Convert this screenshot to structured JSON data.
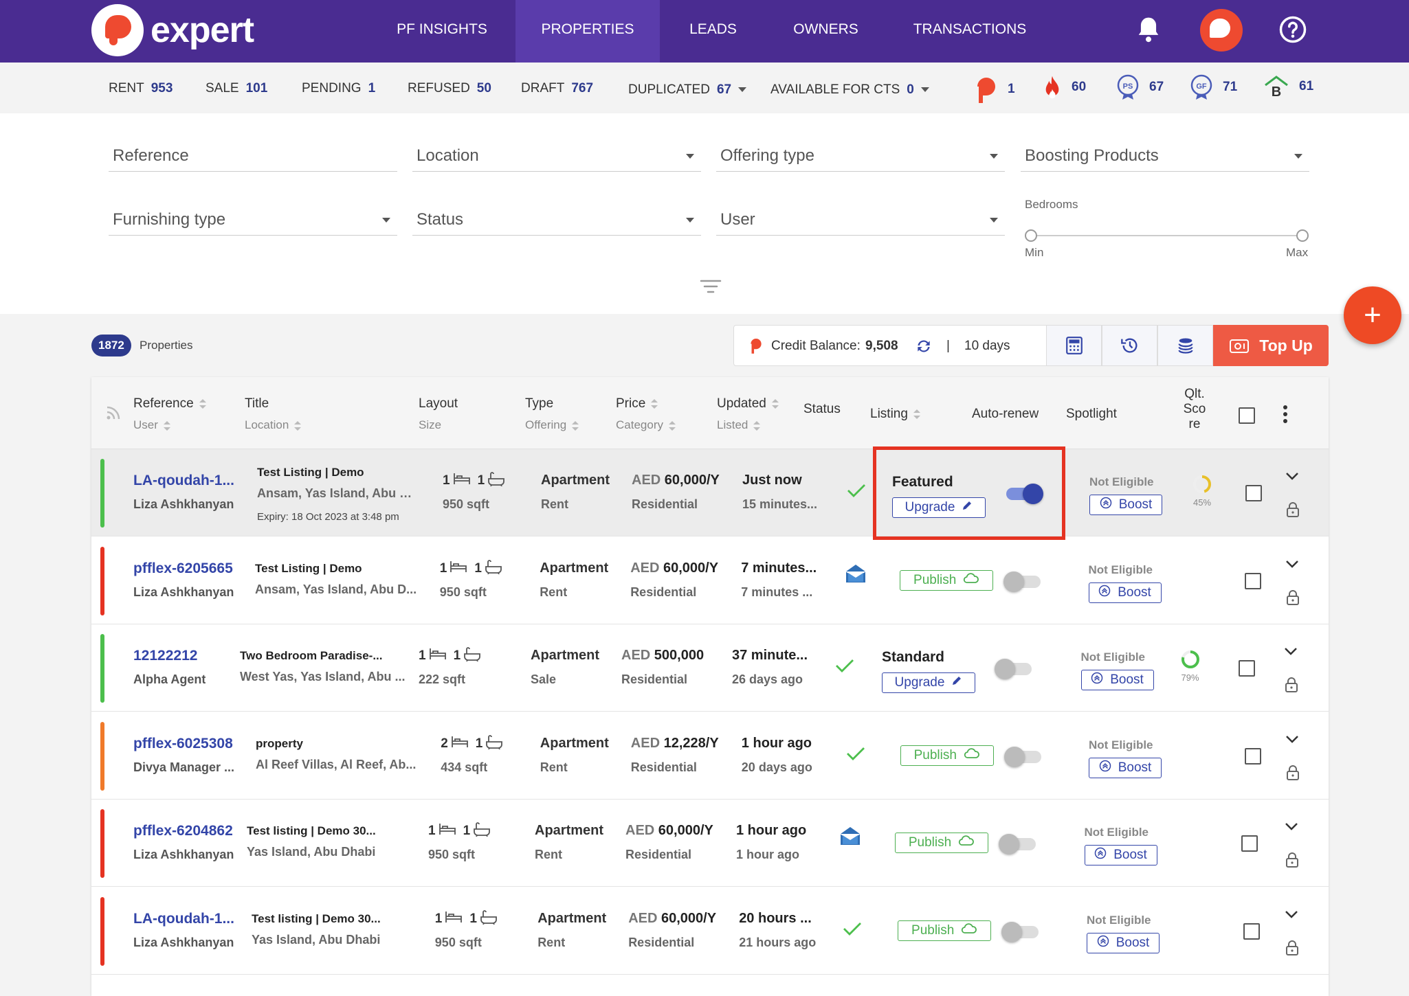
{
  "app": {
    "logo_text": "expert"
  },
  "nav": {
    "items": [
      {
        "label": "PF INSIGHTS",
        "active": false
      },
      {
        "label": "PROPERTIES",
        "active": true
      },
      {
        "label": "LEADS",
        "active": false
      },
      {
        "label": "OWNERS",
        "active": false
      },
      {
        "label": "TRANSACTIONS",
        "active": false
      }
    ]
  },
  "stats": {
    "rent": {
      "label": "RENT",
      "value": "953"
    },
    "sale": {
      "label": "SALE",
      "value": "101"
    },
    "pending": {
      "label": "PENDING",
      "value": "1"
    },
    "refused": {
      "label": "REFUSED",
      "value": "50"
    },
    "draft": {
      "label": "DRAFT",
      "value": "767"
    },
    "duplicated": {
      "label": "DUPLICATED",
      "value": "67"
    },
    "available": {
      "label": "AVAILABLE FOR CTS",
      "value": "0"
    },
    "badges": [
      {
        "icon": "pf-logo-icon",
        "value": "1"
      },
      {
        "icon": "flame-icon",
        "value": "60"
      },
      {
        "icon": "ps-badge-icon",
        "value": "67"
      },
      {
        "icon": "gf-badge-icon",
        "value": "71"
      },
      {
        "icon": "b-house-icon",
        "value": "61"
      }
    ]
  },
  "filters": {
    "reference": "Reference",
    "location": "Location",
    "offering_type": "Offering type",
    "boosting_products": "Boosting Products",
    "furnishing_type": "Furnishing type",
    "status": "Status",
    "user": "User",
    "bedrooms": {
      "label": "Bedrooms",
      "min": "Min",
      "max": "Max"
    }
  },
  "summary": {
    "count": "1872",
    "label": "Properties"
  },
  "credit": {
    "label": "Credit Balance:",
    "value": "9,508",
    "separator": "|",
    "days": "10 days"
  },
  "topup": {
    "label": "Top Up"
  },
  "table": {
    "headers": {
      "reference": "Reference",
      "user": "User",
      "title": "Title",
      "location": "Location",
      "layout": "Layout",
      "size": "Size",
      "type": "Type",
      "offering": "Offering",
      "price": "Price",
      "category": "Category",
      "updated": "Updated",
      "listed": "Listed",
      "status": "Status",
      "listing": "Listing",
      "auto_renew": "Auto-renew",
      "spotlight": "Spotlight",
      "qlt1": "Qlt.",
      "qlt2": "Sco",
      "qlt3": "re"
    },
    "rows": [
      {
        "ref": "LA-qoudah-1...",
        "user": "Liza Ashkhanyan",
        "title": "Test Listing | Demo",
        "location": "Ansam, Yas Island, Abu D...",
        "expiry": "Expiry: 18 Oct 2023 at 3:48 pm",
        "beds": "1",
        "baths": "1",
        "size": "950 sqft",
        "type": "Apartment",
        "offering": "Rent",
        "currency": "AED",
        "price": "60,000/Y",
        "category": "Residential",
        "updated": "Just now",
        "listed": "15 minutes...",
        "status": "check",
        "listing_label": "Featured",
        "listing_action": "Upgrade",
        "auto_renew": true,
        "spotlight": "Not Eligible",
        "boost": "Boost",
        "score": "45%",
        "bar_color": "#4cbf4c"
      },
      {
        "ref": "pfflex-6205665",
        "user": "Liza Ashkhanyan",
        "title": "Test Listing | Demo",
        "location": "Ansam, Yas Island, Abu D...",
        "beds": "1",
        "baths": "1",
        "size": "950 sqft",
        "type": "Apartment",
        "offering": "Rent",
        "currency": "AED",
        "price": "60,000/Y",
        "category": "Residential",
        "updated": "7 minutes...",
        "listed": "7 minutes ...",
        "status": "mail",
        "listing_action": "Publish",
        "auto_renew": false,
        "spotlight": "Not Eligible",
        "boost": "Boost",
        "bar_color": "#e53322"
      },
      {
        "ref": "12122212",
        "user": "Alpha Agent",
        "title": "Two Bedroom Paradise-...",
        "location": "West Yas, Yas Island, Abu ...",
        "beds": "1",
        "baths": "1",
        "size": "222 sqft",
        "type": "Apartment",
        "offering": "Sale",
        "currency": "AED",
        "price": "500,000",
        "category": "Residential",
        "updated": "37 minute...",
        "listed": "26 days ago",
        "status": "check",
        "listing_label": "Standard",
        "listing_action": "Upgrade",
        "auto_renew": false,
        "spotlight": "Not Eligible",
        "boost": "Boost",
        "score": "79%",
        "bar_color": "#4cbf4c"
      },
      {
        "ref": "pfflex-6025308",
        "user": "Divya Manager ...",
        "title": "property",
        "location": "Al Reef Villas, Al Reef, Ab...",
        "beds": "2",
        "baths": "1",
        "size": "434 sqft",
        "type": "Apartment",
        "offering": "Rent",
        "currency": "AED",
        "price": "12,228/Y",
        "category": "Residential",
        "updated": "1 hour ago",
        "listed": "20 days ago",
        "status": "check",
        "listing_action": "Publish",
        "auto_renew": false,
        "spotlight": "Not Eligible",
        "boost": "Boost",
        "bar_color": "#f07a2a"
      },
      {
        "ref": "pfflex-6204862",
        "user": "Liza Ashkhanyan",
        "title": "Test listing | Demo 30...",
        "location": "Yas Island, Abu Dhabi",
        "beds": "1",
        "baths": "1",
        "size": "950 sqft",
        "type": "Apartment",
        "offering": "Rent",
        "currency": "AED",
        "price": "60,000/Y",
        "category": "Residential",
        "updated": "1 hour ago",
        "listed": "1 hour ago",
        "status": "mail",
        "listing_action": "Publish",
        "auto_renew": false,
        "spotlight": "Not Eligible",
        "boost": "Boost",
        "bar_color": "#e53322"
      },
      {
        "ref": "LA-qoudah-1...",
        "user": "Liza Ashkhanyan",
        "title": "Test listing | Demo 30...",
        "location": "Yas Island, Abu Dhabi",
        "beds": "1",
        "baths": "1",
        "size": "950 sqft",
        "type": "Apartment",
        "offering": "Rent",
        "currency": "AED",
        "price": "60,000/Y",
        "category": "Residential",
        "updated": "20 hours ...",
        "listed": "21 hours ago",
        "status": "check",
        "listing_action": "Publish",
        "auto_renew": false,
        "spotlight": "Not Eligible",
        "boost": "Boost",
        "bar_color": "#e53322"
      }
    ]
  }
}
